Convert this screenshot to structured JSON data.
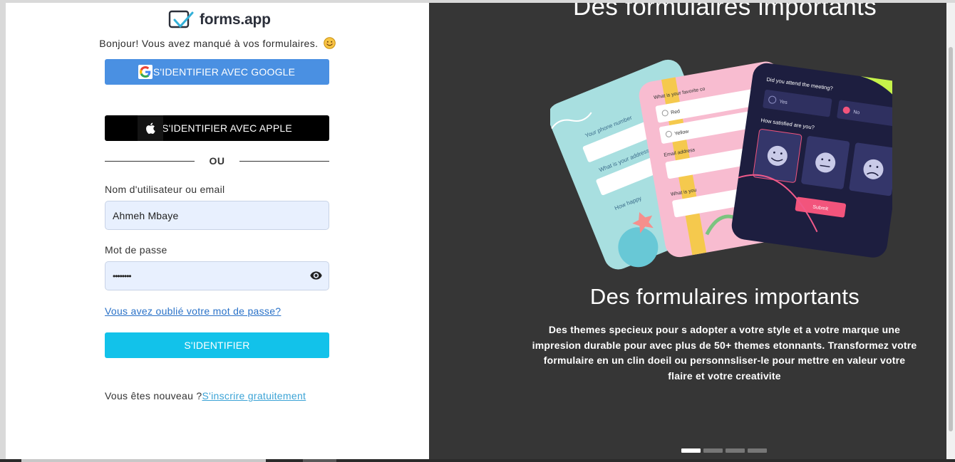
{
  "brand": {
    "name": "forms.app"
  },
  "login": {
    "greeting": "Bonjour! Vous avez manqué à vos formulaires.",
    "google_label": "S'IDENTIFIER AVEC GOOGLE",
    "apple_label": "S'IDENTIFIER AVEC APPLE",
    "divider_text": "OU",
    "username_label": "Nom d'utilisateur ou email",
    "username_value": "Ahmeh Mbaye",
    "password_label": "Mot de passe",
    "password_value": "••••••••",
    "forgot_link": "Vous avez oublié votre mot de passe?",
    "submit_label": "S'IDENTIFIER",
    "signup_prompt": "Vous êtes nouveau ?",
    "signup_link": "S'inscrire gratuitement"
  },
  "showcase": {
    "top_title": "Des formulaires importants",
    "title": "Des formulaires importants",
    "description": "Des themes specieux pour s adopter a votre style et a votre marque une impresion durable pour avec plus de 50+ themes etonnants. Transformez votre formulaire en un clin doeil ou personnsliser-le pour mettre en valeur votre flaire et votre creativite",
    "carousel_total": 4,
    "carousel_active": 1,
    "card_texts": {
      "phone": "Your phone number",
      "address": "What is your address",
      "happy": "How happy",
      "favorite": "What is your favorite co",
      "red": "Red",
      "yellow": "Yellow",
      "email": "Email address",
      "what_is_you": "What is you",
      "q1": "Did you attend the meeting?",
      "yes": "Yes",
      "no": "No",
      "q2": "How satisfied are you?",
      "submit": "Submit"
    }
  },
  "colors": {
    "google_blue": "#4a90e2",
    "apple_black": "#000000",
    "login_cyan": "#12c2ea",
    "input_bg": "#e8f0fe",
    "link_blue": "#2a72c8",
    "panel_dark": "#363636"
  },
  "icons": [
    "google-logo-icon",
    "apple-logo-icon",
    "eye-icon",
    "forms-app-logo-icon",
    "smiley-icon"
  ]
}
